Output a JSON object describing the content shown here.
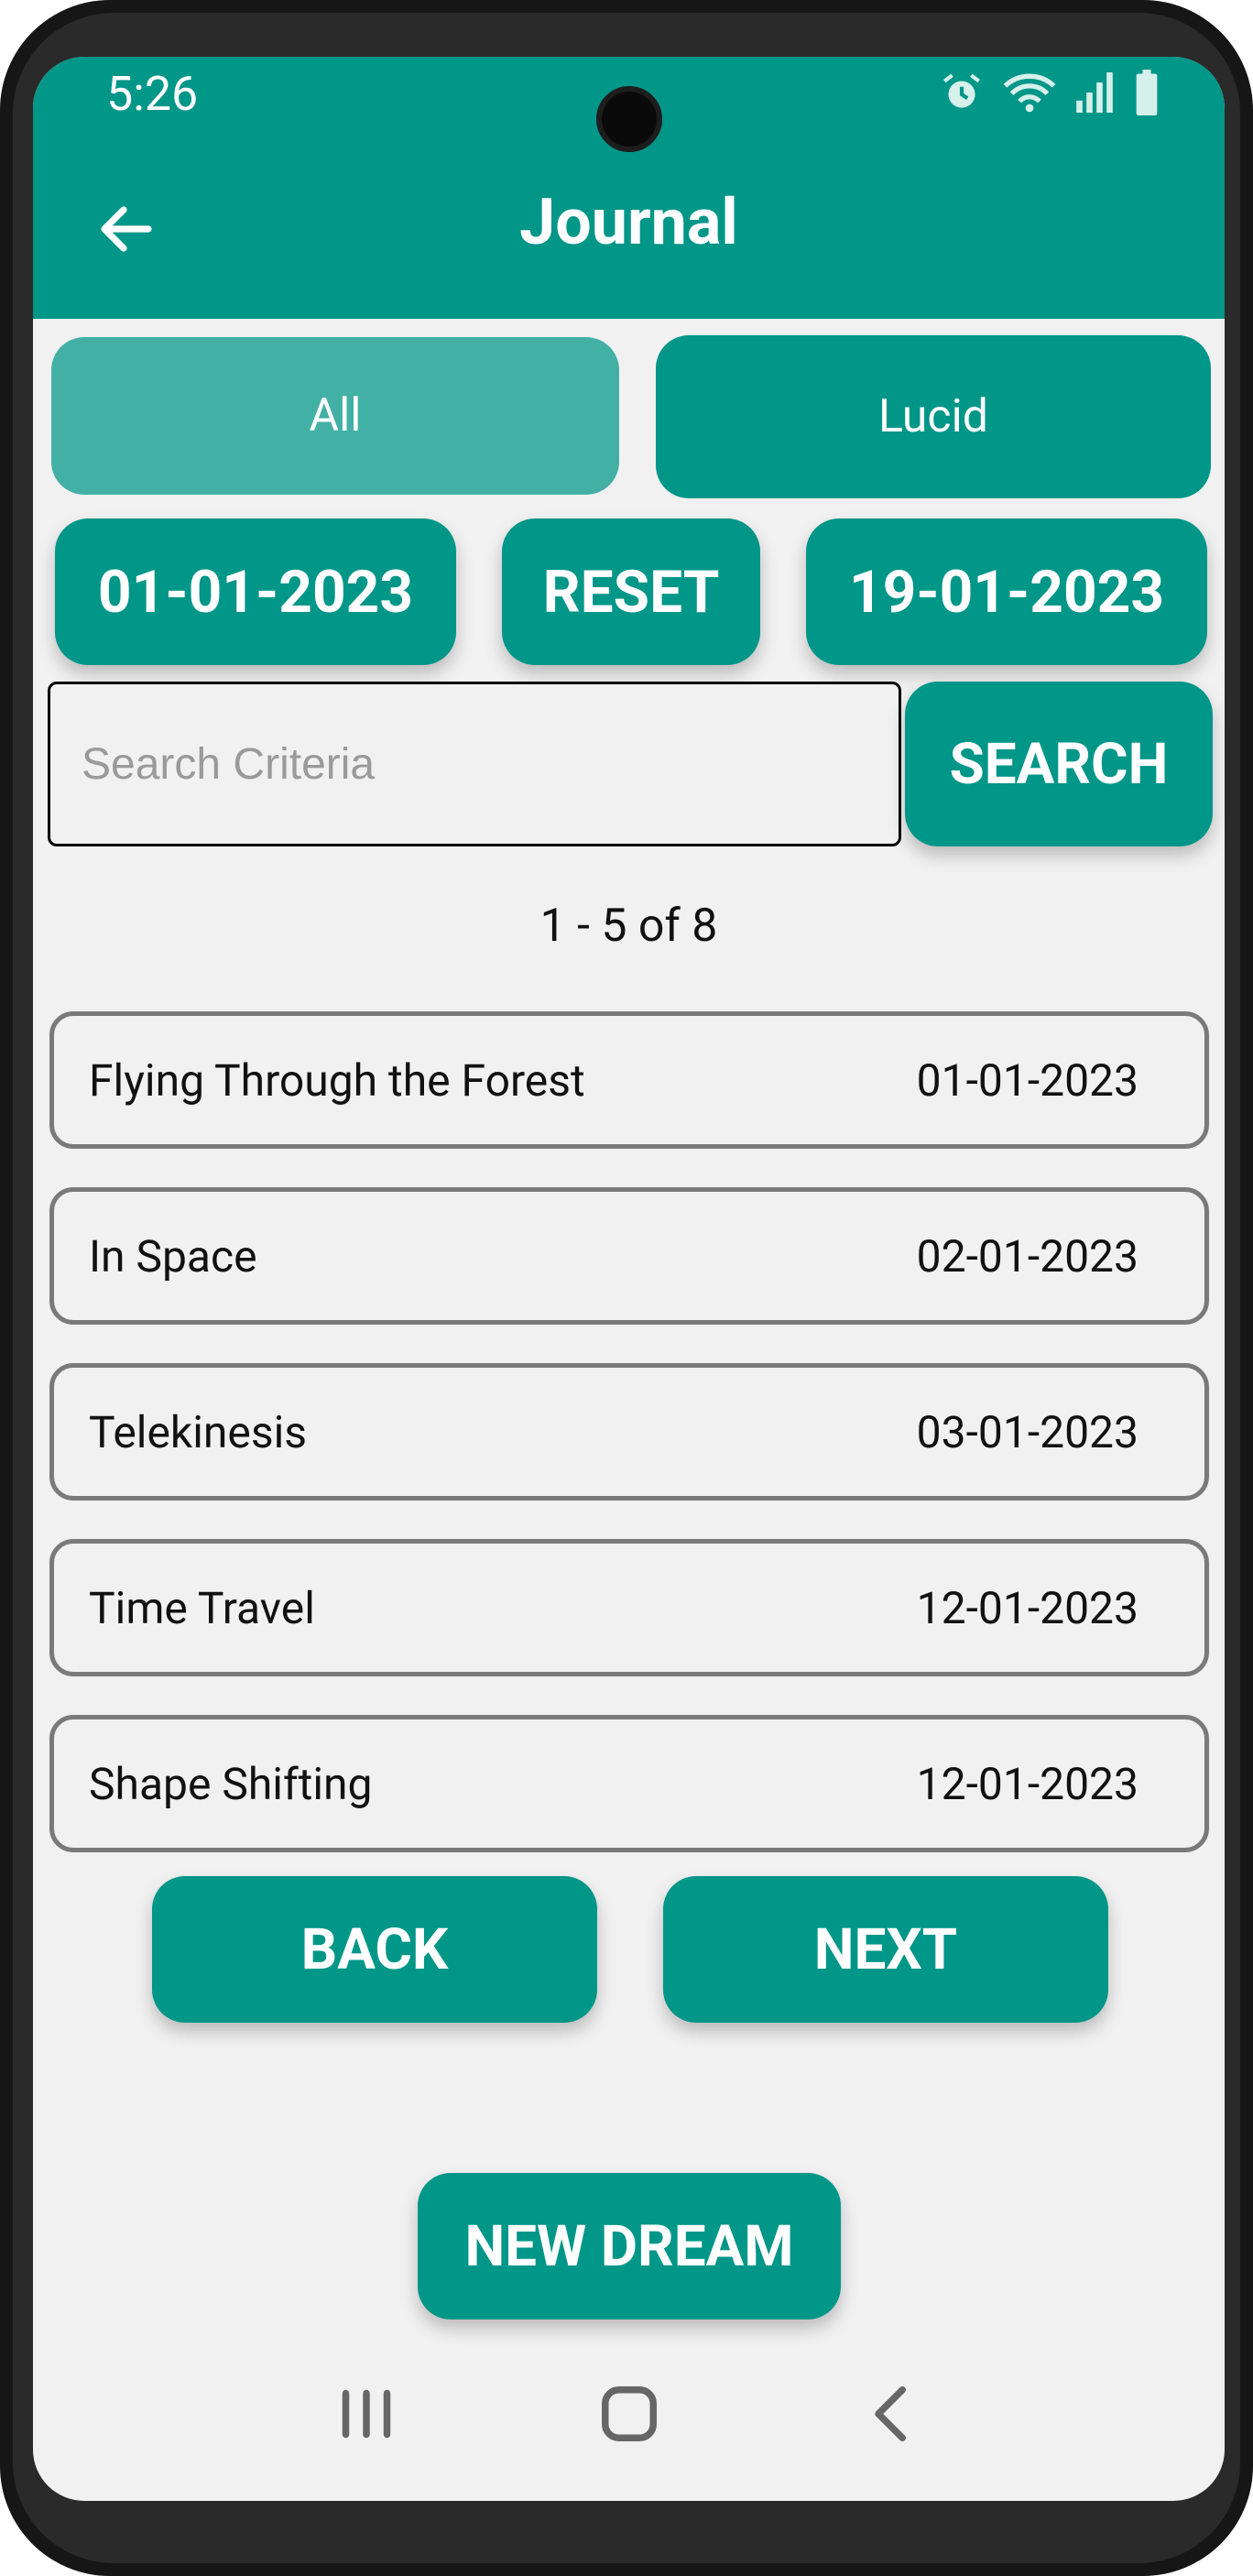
{
  "status_bar": {
    "time": "5:26"
  },
  "app_bar": {
    "title": "Journal"
  },
  "filters": {
    "tabs": [
      "All",
      "Lucid"
    ]
  },
  "date_range": {
    "start": "01-01-2023",
    "reset_label": "RESET",
    "end": "19-01-2023"
  },
  "search": {
    "placeholder": "Search Criteria",
    "value": "",
    "button_label": "SEARCH"
  },
  "pagination": {
    "summary": "1 - 5 of 8",
    "back_label": "BACK",
    "next_label": "NEXT"
  },
  "entries": [
    {
      "title": "Flying Through the Forest",
      "date": "01-01-2023"
    },
    {
      "title": "In Space",
      "date": "02-01-2023"
    },
    {
      "title": "Telekinesis",
      "date": "03-01-2023"
    },
    {
      "title": "Time Travel",
      "date": "12-01-2023"
    },
    {
      "title": "Shape Shifting",
      "date": "12-01-2023"
    }
  ],
  "actions": {
    "new_dream_label": "NEW DREAM"
  },
  "colors": {
    "primary": "#009688",
    "primary_light": "#43b0a5",
    "background": "#f1f1f1"
  }
}
